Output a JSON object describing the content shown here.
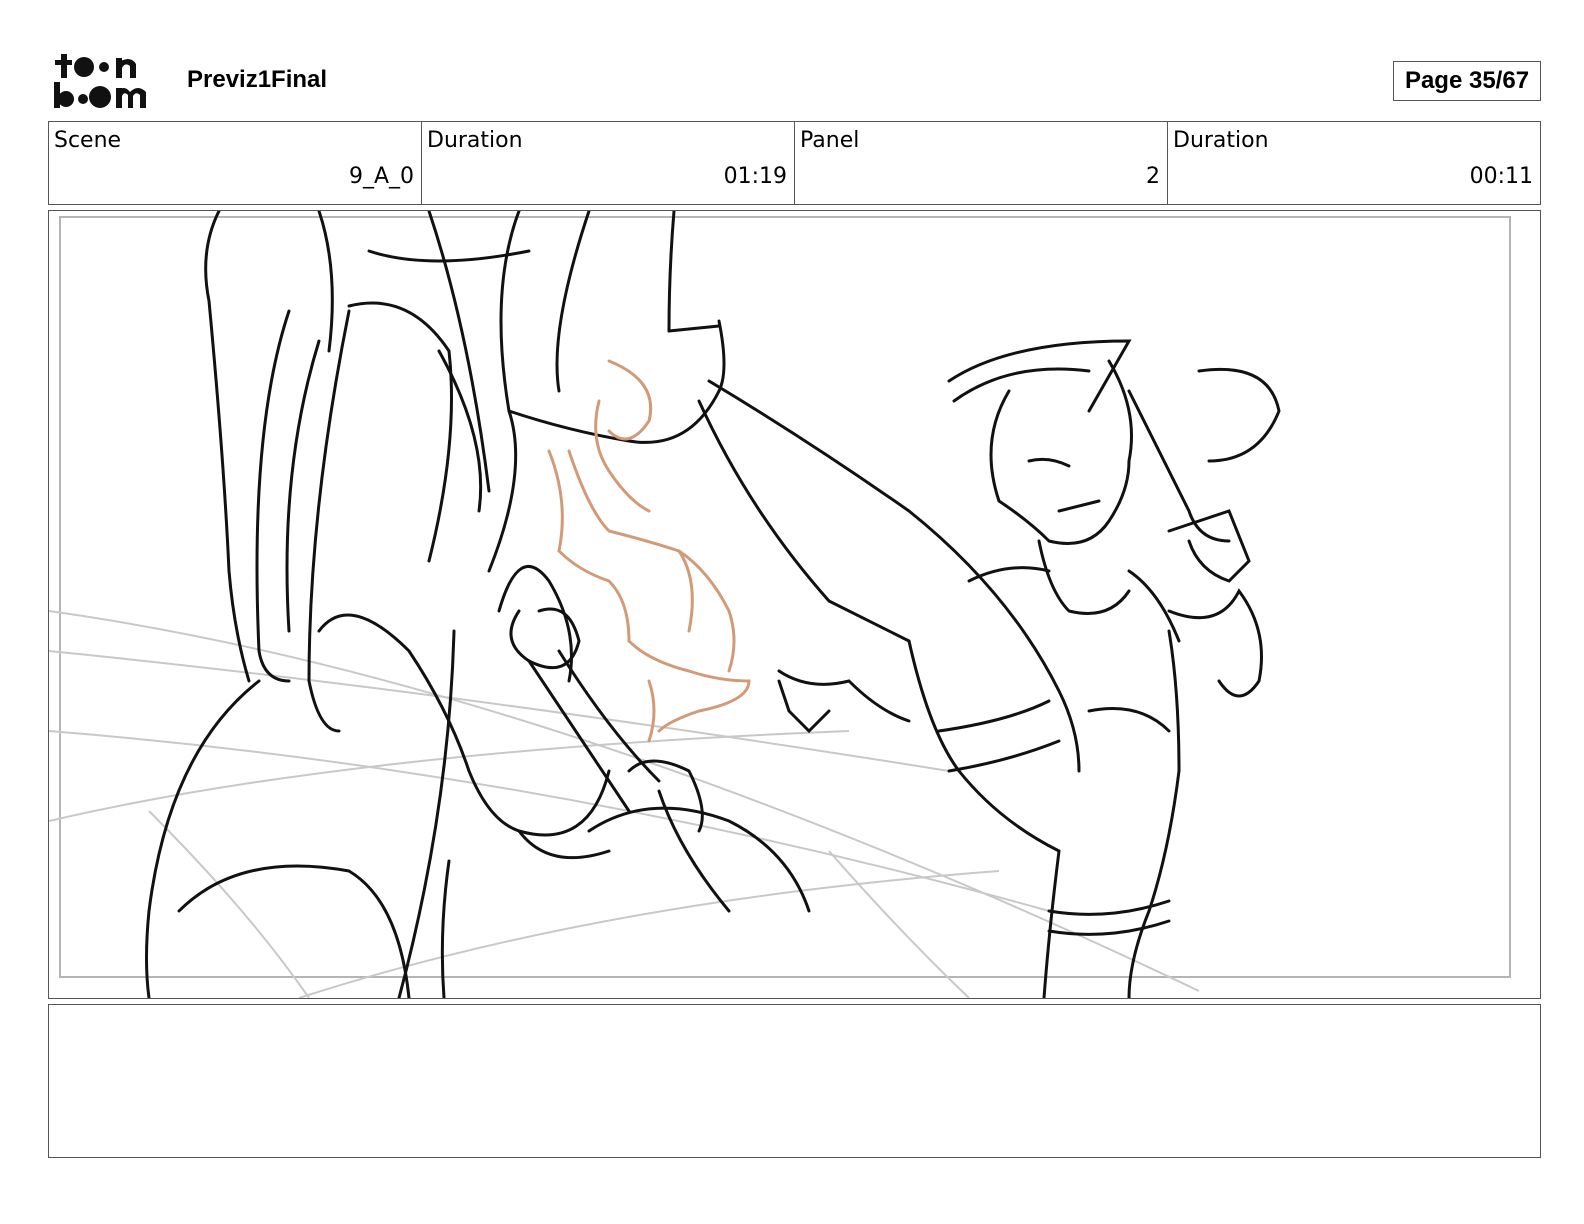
{
  "header": {
    "project_title": "Previz1Final",
    "page_label": "Page 35/67"
  },
  "info": {
    "scene_label": "Scene",
    "scene_value": "9_A_0",
    "duration_label": "Duration",
    "duration_value": "01:19",
    "panel_label": "Panel",
    "panel_value": "2",
    "panel_duration_label": "Duration",
    "panel_duration_value": "00:11"
  },
  "colors": {
    "sketch_ink": "#111111",
    "fire_sketch": "#d39a78",
    "guide_lines": "#c8c8c8",
    "border": "#555555"
  }
}
